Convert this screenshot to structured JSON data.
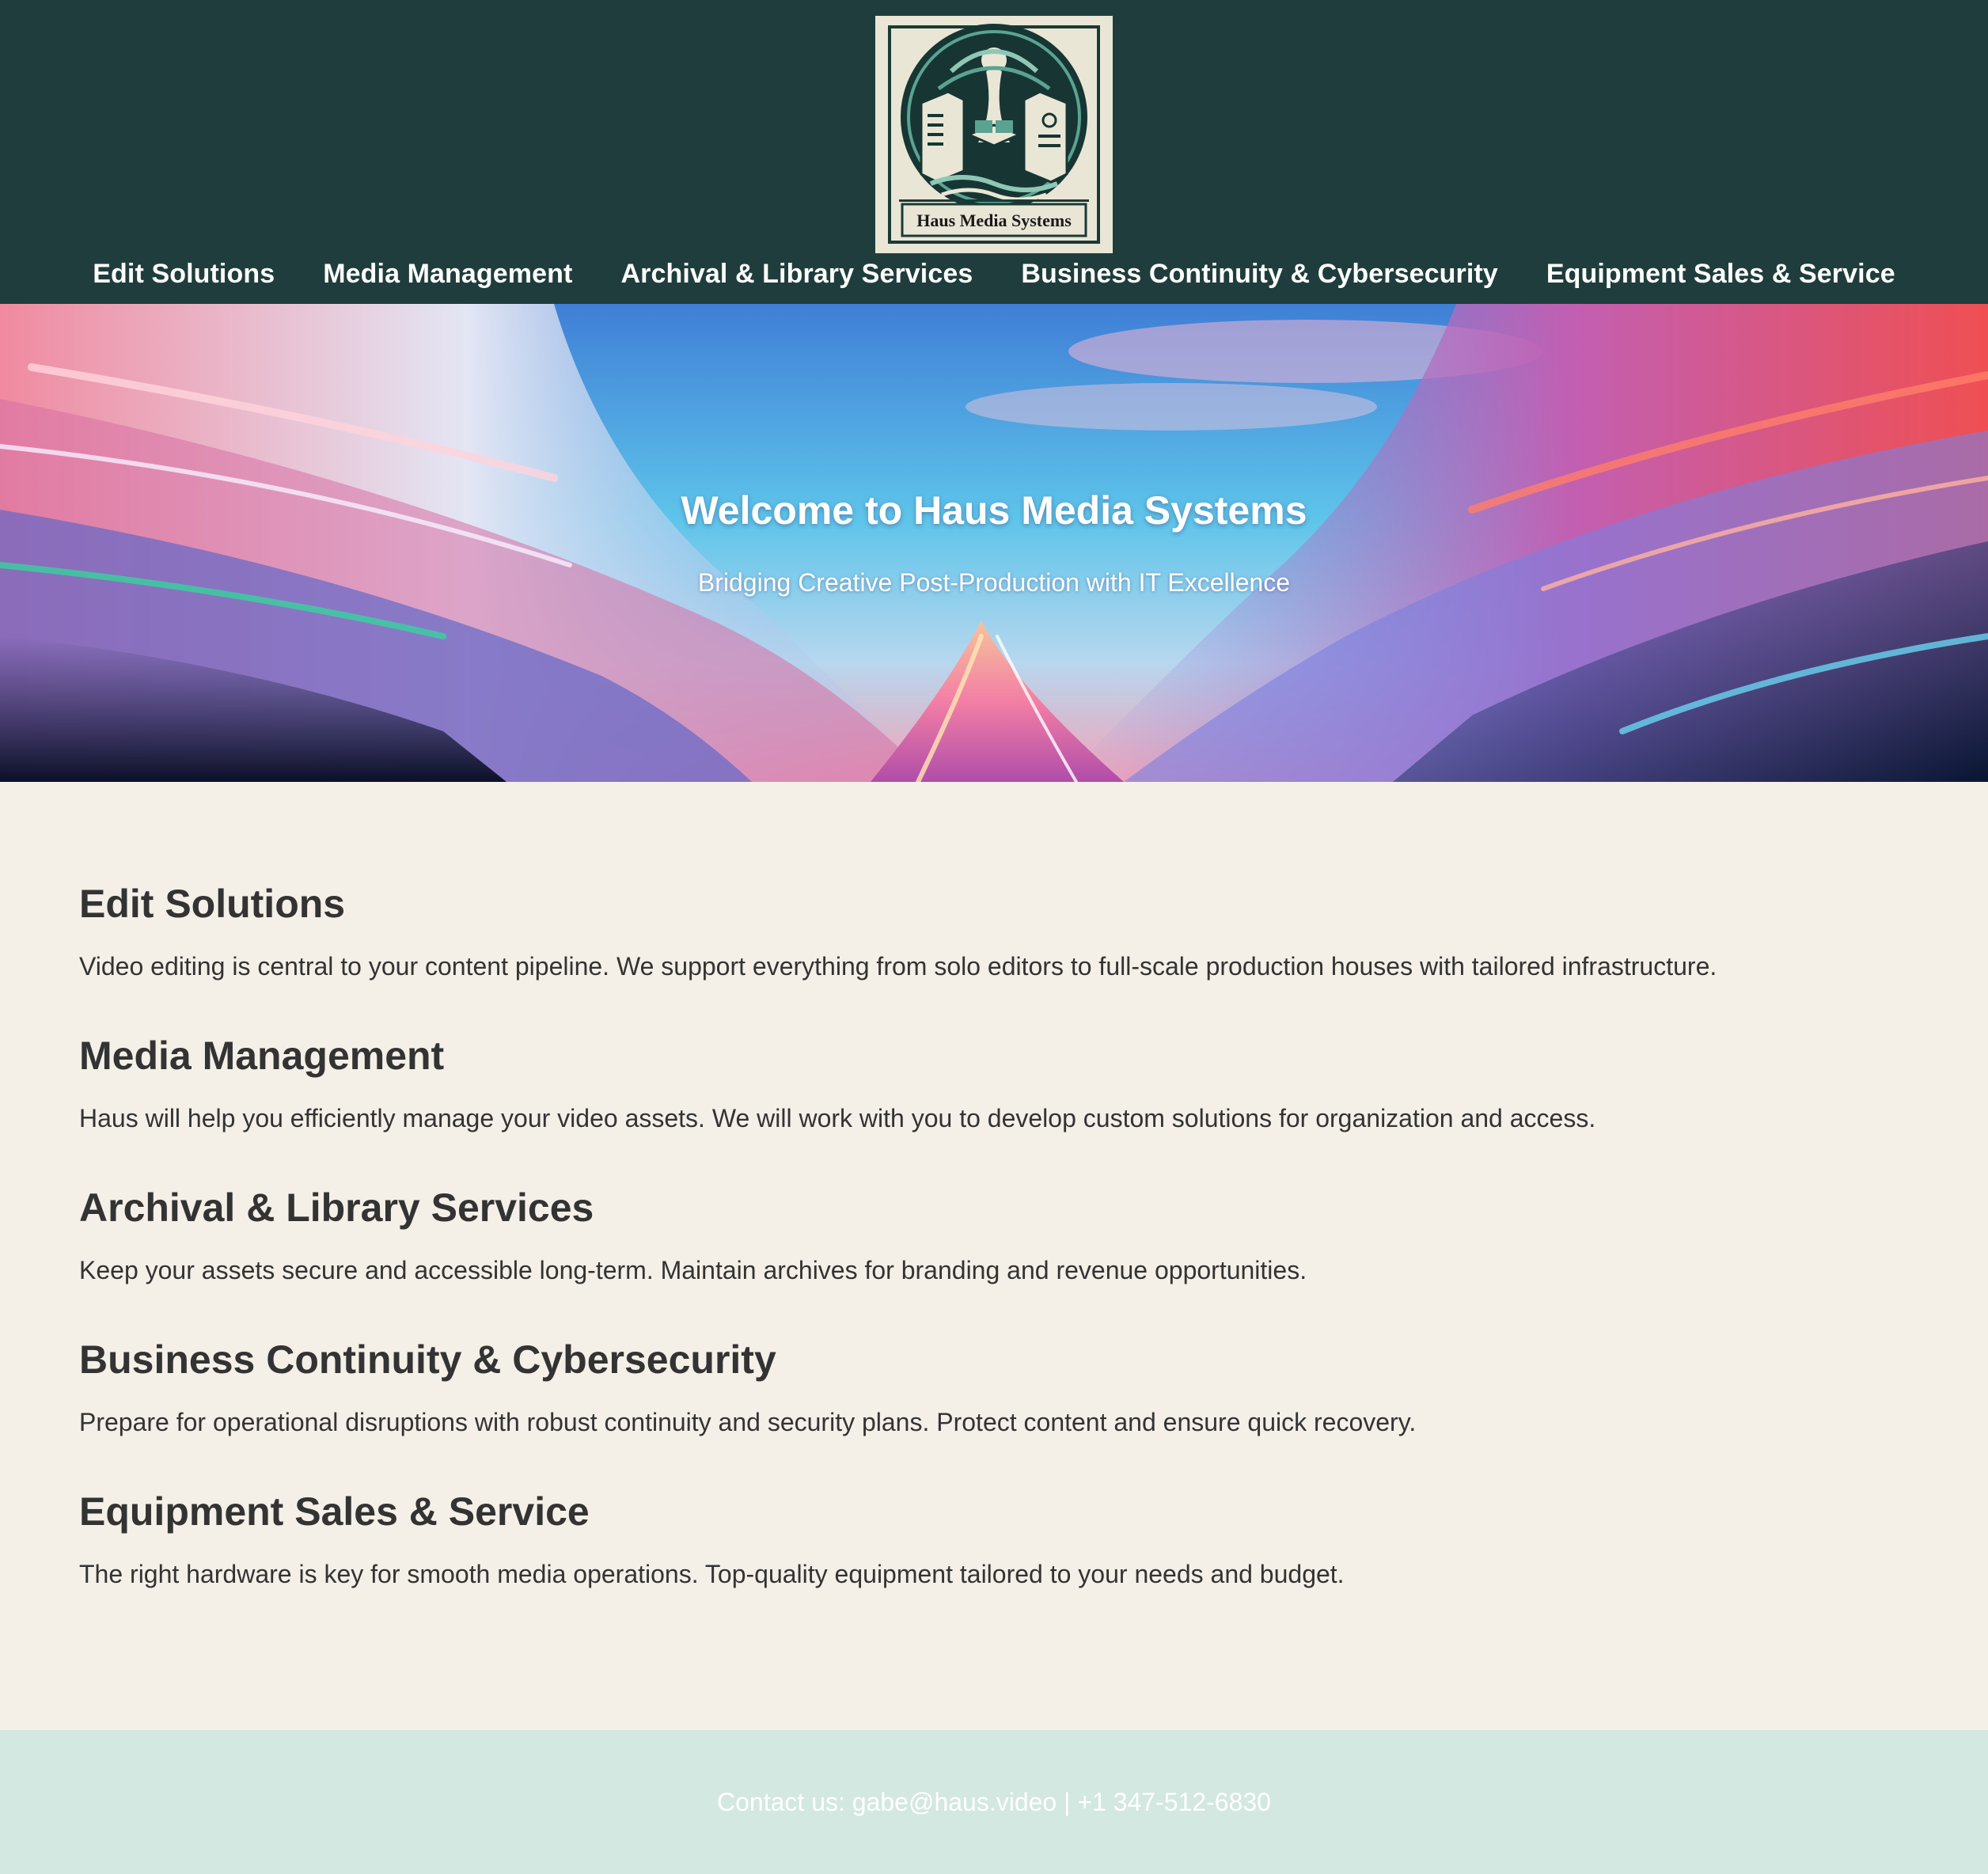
{
  "header": {
    "logo_text": "Haus Media Systems",
    "background_color": "#1f3d3c",
    "nav": [
      {
        "label": "Edit Solutions"
      },
      {
        "label": "Media Management"
      },
      {
        "label": "Archival & Library Services"
      },
      {
        "label": "Business Continuity & Cybersecurity"
      },
      {
        "label": "Equipment Sales & Service"
      }
    ]
  },
  "hero": {
    "title": "Welcome to Haus Media Systems",
    "subtitle": "Bridging Creative Post-Production with IT Excellence"
  },
  "sections": [
    {
      "heading": "Edit Solutions",
      "text": "Video editing is central to your content pipeline. We support everything from solo editors to full-scale production houses with tailored infrastructure."
    },
    {
      "heading": "Media Management",
      "text": "Haus will help you efficiently manage your video assets. We will work with you to develop custom solutions for organization and access."
    },
    {
      "heading": "Archival & Library Services",
      "text": "Keep your assets secure and accessible long-term. Maintain archives for branding and revenue opportunities."
    },
    {
      "heading": "Business Continuity & Cybersecurity",
      "text": "Prepare for operational disruptions with robust continuity and security plans. Protect content and ensure quick recovery."
    },
    {
      "heading": "Equipment Sales & Service",
      "text": "The right hardware is key for smooth media operations. Top-quality equipment tailored to your needs and budget."
    }
  ],
  "footer": {
    "contact": "Contact us: gabe@haus.video | +1 347-512-6830",
    "background_color": "#d3e8e0"
  },
  "colors": {
    "page_background": "#f4f0e8",
    "text": "#333333"
  }
}
